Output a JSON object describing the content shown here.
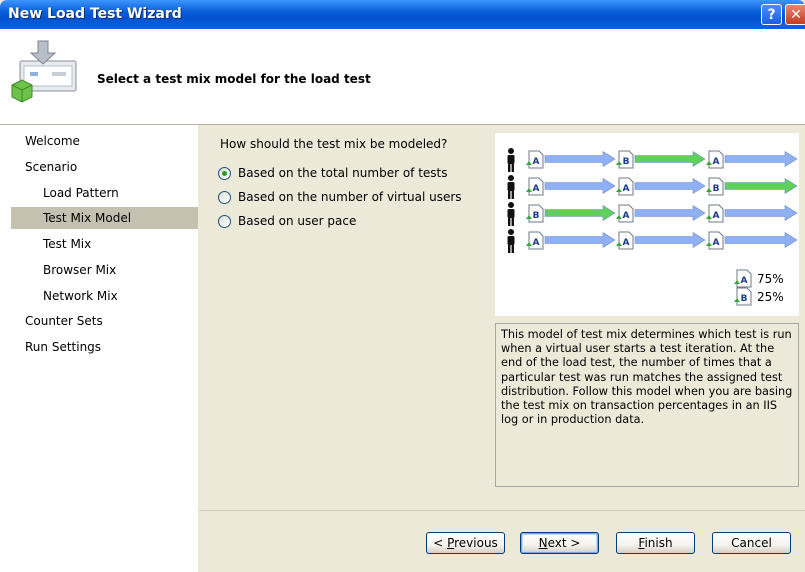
{
  "window": {
    "title": "New Load Test Wizard",
    "help_glyph": "?",
    "close_glyph": "✕"
  },
  "header": {
    "title": "Select a test mix model for the load test"
  },
  "sidebar": {
    "items": [
      {
        "label": "Welcome",
        "indent": false,
        "selected": false
      },
      {
        "label": "Scenario",
        "indent": false,
        "selected": false
      },
      {
        "label": "Load Pattern",
        "indent": true,
        "selected": false
      },
      {
        "label": "Test Mix Model",
        "indent": true,
        "selected": true
      },
      {
        "label": "Test Mix",
        "indent": true,
        "selected": false
      },
      {
        "label": "Browser Mix",
        "indent": true,
        "selected": false
      },
      {
        "label": "Network Mix",
        "indent": true,
        "selected": false
      },
      {
        "label": "Counter Sets",
        "indent": false,
        "selected": false
      },
      {
        "label": "Run Settings",
        "indent": false,
        "selected": false
      }
    ]
  },
  "main": {
    "question": "How should the test mix be modeled?",
    "options": [
      {
        "label": "Based on the total number of tests",
        "checked": true
      },
      {
        "label": "Based on the number of virtual users",
        "checked": false
      },
      {
        "label": "Based on user pace",
        "checked": false
      }
    ],
    "diagram": {
      "rows": [
        [
          "A",
          "B",
          "A"
        ],
        [
          "A",
          "A",
          "B"
        ],
        [
          "B",
          "A",
          "A"
        ],
        [
          "A",
          "A",
          "A"
        ]
      ],
      "legend": [
        {
          "test": "A",
          "percent": "75%"
        },
        {
          "test": "B",
          "percent": "25%"
        }
      ],
      "colors": {
        "blue_arrow": "#8fb0f4",
        "green_arrow": "#5fd15a"
      }
    },
    "description": "This model of test mix determines which test is run when a virtual user starts a test iteration. At the end of the load test, the number of times that a particular test was run matches the assigned test distribution. Follow this model when you are basing the test mix on transaction percentages in an IIS log or in production data."
  },
  "buttons": {
    "previous_prefix": "< ",
    "previous_key": "P",
    "previous_rest": "revious",
    "next_key": "N",
    "next_rest": "ext >",
    "finish_key": "F",
    "finish_rest": "inish",
    "cancel": "Cancel"
  }
}
